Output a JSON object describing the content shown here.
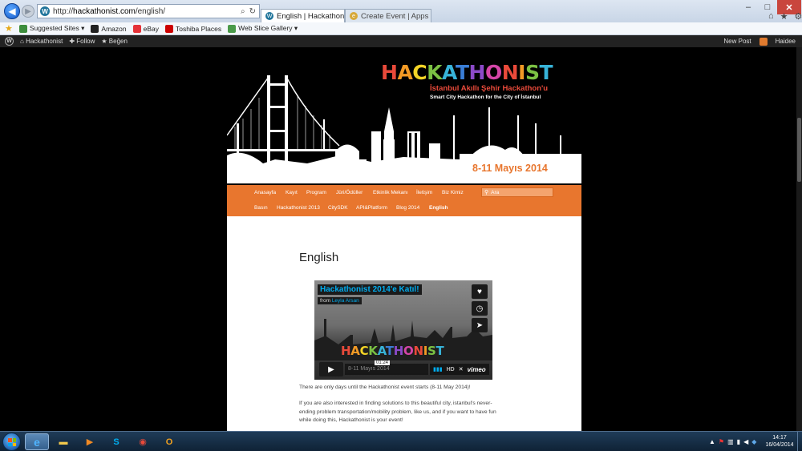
{
  "browser": {
    "url_prefix": "http://",
    "url_host": "hackathonist.com",
    "url_path": "/english/",
    "tabs": [
      {
        "label": "English | Hackathonist",
        "active": true
      },
      {
        "label": "Create Event | Apps for Europe",
        "active": false
      }
    ],
    "window_controls": {
      "minimize": "–",
      "maximize": "□",
      "close": "✕"
    },
    "icons": {
      "back": "◀",
      "forward": "▶",
      "search": "⌕",
      "refresh": "↻",
      "home": "⌂",
      "favorites": "★",
      "settings": "⚙"
    }
  },
  "favorites_bar": {
    "items": [
      "Suggested Sites ▾",
      "Amazon",
      "eBay",
      "Toshiba Places",
      "Web Slice Gallery ▾"
    ]
  },
  "admin_bar": {
    "site": "Hackathonist",
    "follow": "Follow",
    "like": "Beğen",
    "new_post": "New Post",
    "user": "Haidee"
  },
  "header": {
    "logo_letters": [
      "H",
      "A",
      "C",
      "K",
      "A",
      "T",
      "H",
      "O",
      "N",
      "I",
      "S",
      "T"
    ],
    "subtitle_tr": "İstanbul Akıllı Şehir Hackathon'u",
    "subtitle_en": "Smart City Hackathon for the City of İstanbul",
    "dates": "8-11 Mayıs 2014"
  },
  "menu": {
    "row1": [
      "Anasayfa",
      "Kayıt",
      "Program",
      "Jüri/Ödüller",
      "Etkinlik Mekanı",
      "İletişim",
      "Biz Kimiz"
    ],
    "row2": [
      "Basın",
      "Hackathonist 2013",
      "CitySDK",
      "API&Platform",
      "Blog 2014",
      "English"
    ],
    "search_placeholder": "Ara"
  },
  "content": {
    "title": "English",
    "video": {
      "title": "Hackathonist 2014'e Katıl!",
      "from_label": "from",
      "author": "Leyla Arsan",
      "logo": "HACKATHONIST",
      "date_text": "8-11 Mayıs 2014",
      "time": "01:24",
      "hd": "HD",
      "brand": "vimeo"
    },
    "paragraph1": "There are only days until the Hackathonist event starts (8-11 May 2014)!",
    "paragraph2": "If you are also interested in finding solutions to this beautiful city, istanbul's never-ending problem transportation/mobility problem, like us, and if you want to have fun while doing this, Hackathonist is your event!"
  },
  "colors": {
    "accent": "#e8762e",
    "video_link": "#00adef"
  },
  "taskbar": {
    "time": "14:17",
    "date": "16/04/2014"
  }
}
